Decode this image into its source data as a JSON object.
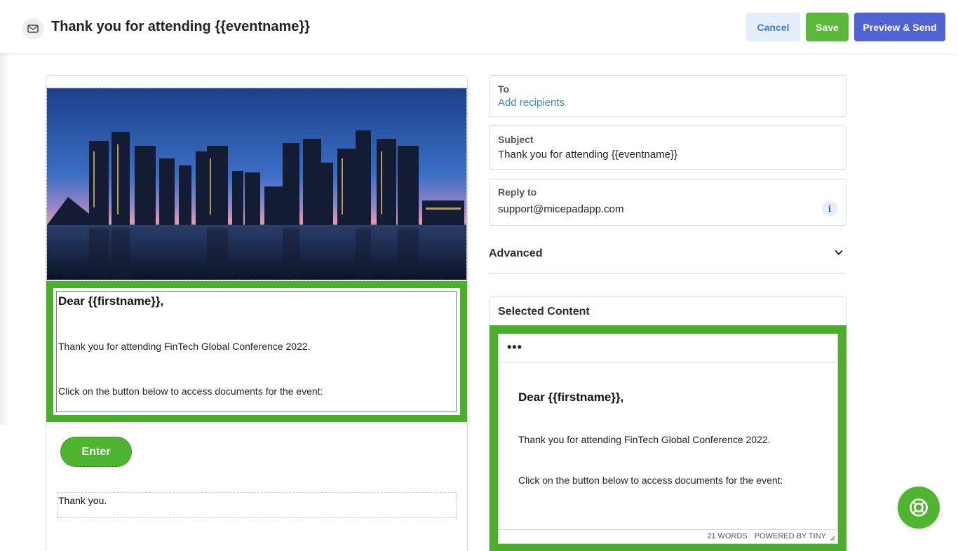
{
  "header": {
    "title": "Thank you for attending {{eventname}}",
    "cancel_label": "Cancel",
    "save_label": "Save",
    "send_label": "Preview & Send"
  },
  "email": {
    "greeting": "Dear {{firstname}},",
    "line1": "Thank you for attending FinTech Global Conference 2022.",
    "line2": "Click on the button below to access documents for the event:",
    "button_label": "Enter",
    "closing": "Thank you."
  },
  "form": {
    "to_label": "To",
    "to_value": "Add recipients",
    "subject_label": "Subject",
    "subject_value": "Thank you for attending {{eventname}}",
    "reply_label": "Reply to",
    "reply_value": "support@micepadapp.com",
    "info_glyph": "i",
    "advanced_label": "Advanced"
  },
  "editor": {
    "section_title": "Selected Content",
    "more_glyph": "•••",
    "greeting": "Dear {{firstname}},",
    "line1": "Thank you for attending FinTech Global Conference 2022.",
    "line2": "Click on the button below to access documents for the event:",
    "word_count": "21 WORDS",
    "powered_by": "POWERED BY TINY"
  },
  "colors": {
    "accent_green": "#4caf2b",
    "primary_blue": "#4f63d2",
    "link_blue": "#3f86d6"
  },
  "icons": [
    "envelope-icon",
    "info-icon",
    "chevron-down-icon",
    "help-chat-icon",
    "resize-handle-icon"
  ]
}
